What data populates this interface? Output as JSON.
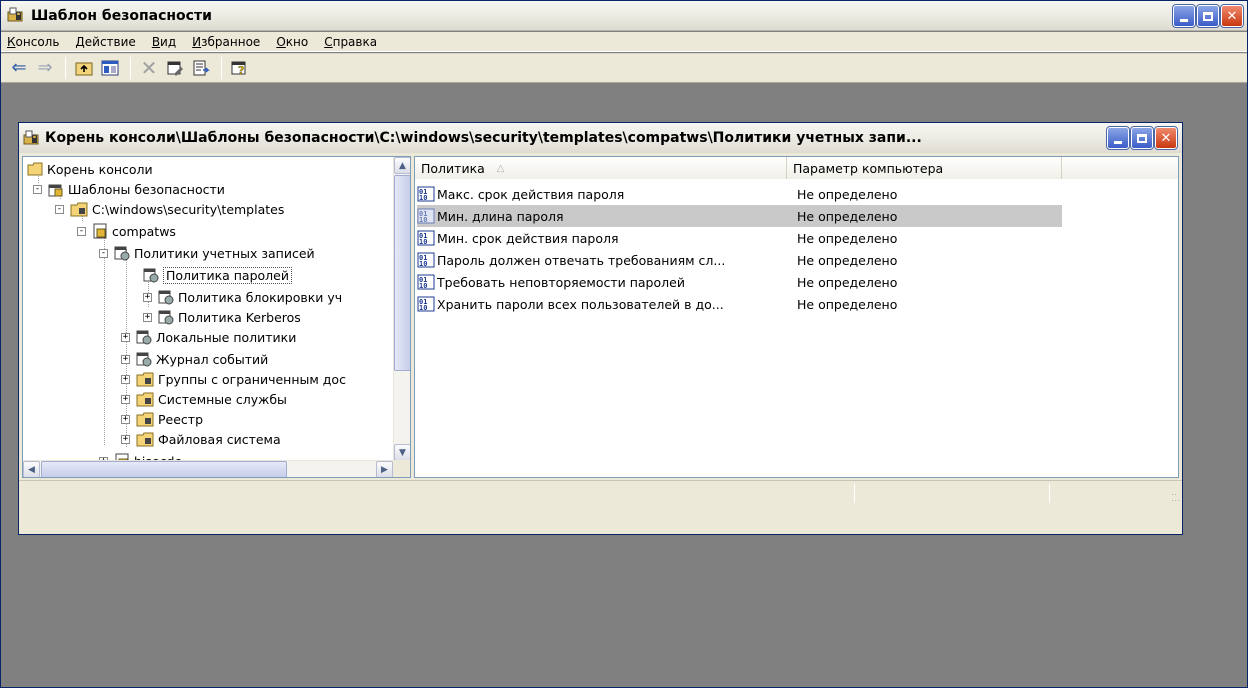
{
  "window": {
    "title": "Шаблон безопасности"
  },
  "menubar": {
    "items": [
      {
        "label": "Консоль"
      },
      {
        "label": "Действие"
      },
      {
        "label": "Вид"
      },
      {
        "label": "Избранное"
      },
      {
        "label": "Окно"
      },
      {
        "label": "Справка"
      }
    ]
  },
  "toolbar": {
    "icons": [
      "back-arrow-icon",
      "forward-arrow-icon",
      "up-folder-icon",
      "show-hide-tree-icon",
      "delete-icon",
      "properties-icon",
      "export-list-icon",
      "help-icon"
    ]
  },
  "child_window": {
    "title": "Корень консоли\\Шаблоны безопасности\\C:\\windows\\security\\templates\\compatws\\Политики учетных запи..."
  },
  "tree": {
    "items": [
      {
        "label": "Корень консоли",
        "icon": "folder-icon"
      },
      {
        "label": "Шаблоны безопасности",
        "icon": "security-templates-icon",
        "expander": "-"
      },
      {
        "label": "C:\\windows\\security\\templates",
        "icon": "templates-folder-icon",
        "expander": "-"
      },
      {
        "label": "compatws",
        "icon": "template-icon",
        "expander": "-"
      },
      {
        "label": "Политики учетных записей",
        "icon": "policy-icon",
        "expander": "-"
      },
      {
        "label": "Политика паролей",
        "icon": "policy-icon",
        "selected": true
      },
      {
        "label": "Политика блокировки уч",
        "icon": "policy-icon",
        "expander": "+"
      },
      {
        "label": "Политика Kerberos",
        "icon": "policy-icon",
        "expander": "+"
      },
      {
        "label": "Локальные политики",
        "icon": "policy-icon",
        "expander": "+"
      },
      {
        "label": "Журнал событий",
        "icon": "policy-icon",
        "expander": "+"
      },
      {
        "label": "Группы с ограниченным дос",
        "icon": "templates-folder-icon",
        "expander": "+"
      },
      {
        "label": "Системные службы",
        "icon": "templates-folder-icon",
        "expander": "+"
      },
      {
        "label": "Реестр",
        "icon": "templates-folder-icon",
        "expander": "+"
      },
      {
        "label": "Файловая система",
        "icon": "templates-folder-icon",
        "expander": "+"
      },
      {
        "label": "hisecdc",
        "icon": "template-icon",
        "expander": "+"
      }
    ]
  },
  "list": {
    "columns": [
      {
        "label": "Политика"
      },
      {
        "label": "Параметр компьютера"
      }
    ],
    "rows": [
      {
        "policy": "Макс. срок действия пароля",
        "value": "Не определено"
      },
      {
        "policy": "Мин. длина пароля",
        "value": "Не определено",
        "selected": true
      },
      {
        "policy": "Мин. срок действия пароля",
        "value": "Не определено"
      },
      {
        "policy": "Пароль должен отвечать требованиям сл...",
        "value": "Не определено"
      },
      {
        "policy": "Требовать неповторяемости паролей",
        "value": "Не определено"
      },
      {
        "policy": "Хранить пароли всех пользователей в до...",
        "value": "Не определено"
      }
    ]
  },
  "colors": {
    "workspace": "#808080",
    "chrome": "#ece9d8",
    "selection": "#c9c9c9",
    "close_button": "#c8380e",
    "title_button": "#3a5cc8"
  }
}
